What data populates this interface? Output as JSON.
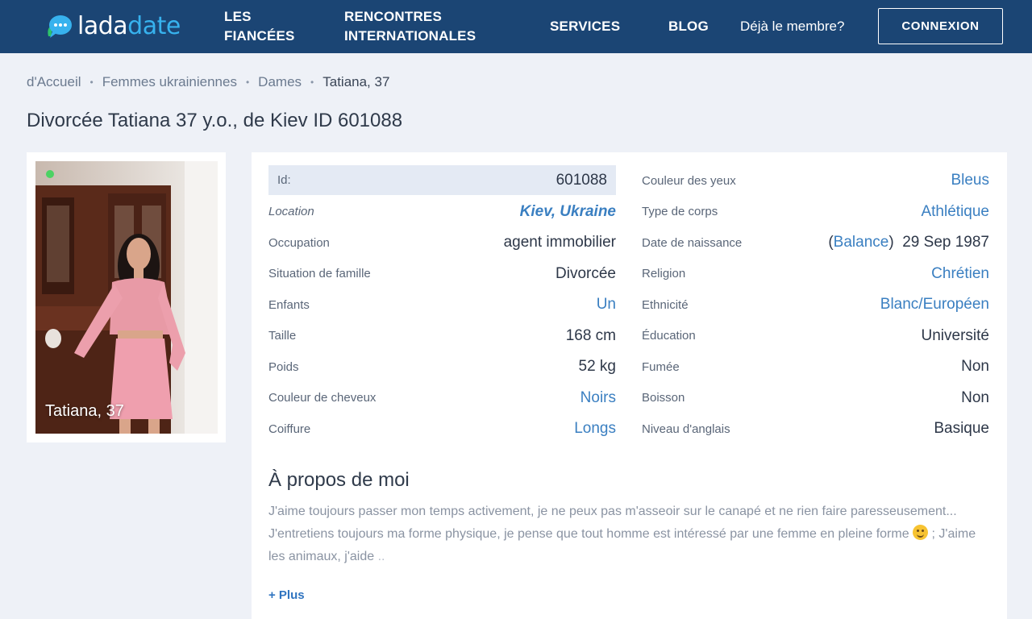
{
  "header": {
    "logo_part1": "lada",
    "logo_part2": "date",
    "nav": {
      "fiancees_line1": "LES",
      "fiancees_line2": "FIANCÉES",
      "rencontres_line1": "RENCONTRES",
      "rencontres_line2": "INTERNATIONALES",
      "services": "SERVICES",
      "blog": "BLOG"
    },
    "member_question": "Déjà le membre?",
    "login_label": "CONNEXION"
  },
  "breadcrumb": {
    "items": [
      "d'Accueil",
      "Femmes ukrainiennes",
      "Dames"
    ],
    "current": "Tatiana, 37"
  },
  "page_title": "Divorcée Tatiana 37 y.o., de Kiev ID 601088",
  "photo": {
    "caption": "Tatiana, 37"
  },
  "profile_left": [
    {
      "label": "Id:",
      "value": "601088"
    },
    {
      "label": "Location",
      "value": "Kiev, Ukraine"
    },
    {
      "label": "Occupation",
      "value": "agent immobilier"
    },
    {
      "label": "Situation de famille",
      "value": "Divorcée"
    },
    {
      "label": "Enfants",
      "value": "Un"
    },
    {
      "label": "Taille",
      "value": "168 cm"
    },
    {
      "label": "Poids",
      "value": "52 kg"
    },
    {
      "label": "Couleur de cheveux",
      "value": "Noirs"
    },
    {
      "label": "Coiffure",
      "value": "Longs"
    }
  ],
  "profile_right": [
    {
      "label": "Couleur des yeux",
      "value": "Bleus"
    },
    {
      "label": "Type de corps",
      "value": "Athlétique"
    },
    {
      "label": "Date de naissance",
      "zodiac": "Balance",
      "value": "29 Sep 1987"
    },
    {
      "label": "Religion",
      "value": "Chrétien"
    },
    {
      "label": "Ethnicité",
      "value": "Blanc/Européen"
    },
    {
      "label": "Éducation",
      "value": "Université"
    },
    {
      "label": "Fumée",
      "value": "Non"
    },
    {
      "label": "Boisson",
      "value": "Non"
    },
    {
      "label": "Niveau d'anglais",
      "value": "Basique"
    }
  ],
  "about": {
    "title": "À propos de moi",
    "text_part1": "J'aime toujours passer mon temps activement, je ne peux pas m'asseoir sur le canapé et ne rien faire paresseusement... J'entretiens toujours ma forme physique, je pense que tout homme est intéressé par une femme en pleine forme",
    "text_part2": " ; J'aime les animaux, j'aide",
    "text_fade": " ..",
    "more_label": "+ Plus"
  },
  "colors": {
    "header_bg": "#1b4574",
    "accent": "#37b2ee",
    "link": "#3a7fc1",
    "online": "#4cd263"
  }
}
